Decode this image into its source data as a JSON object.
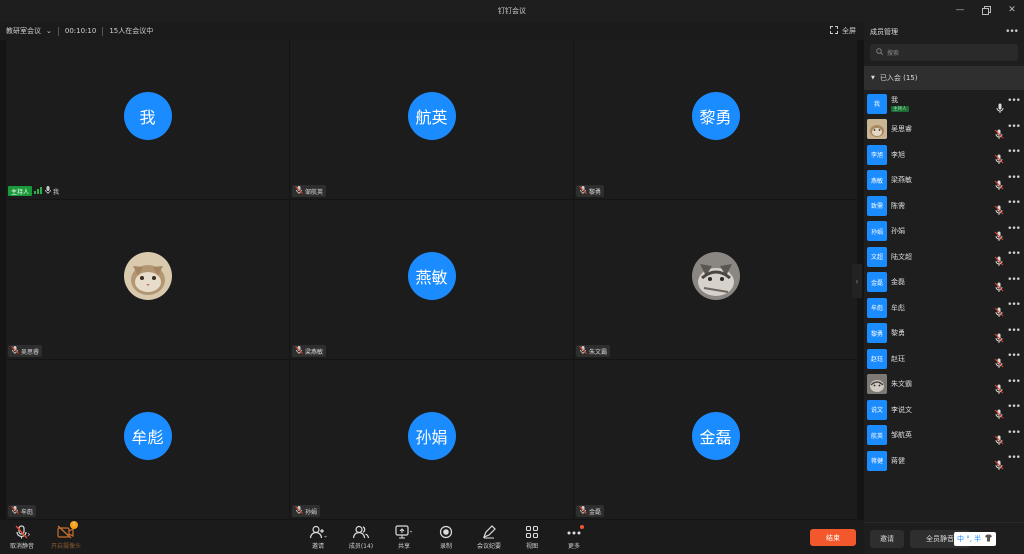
{
  "window": {
    "title": "钉钉会议"
  },
  "infobar": {
    "meeting_name": "教研室会议",
    "elapsed": "00:10:10",
    "attendance": "15人在会议中",
    "fullscreen_label": "全屏"
  },
  "tiles": [
    {
      "avatar_text": "我",
      "name": "我",
      "host_label": "主持人"
    },
    {
      "avatar_text": "航英",
      "name": "邹航英"
    },
    {
      "avatar_text": "黎勇",
      "name": "黎勇"
    },
    {
      "avatar_text": "",
      "name": "吴思睿"
    },
    {
      "avatar_text": "燕敏",
      "name": "梁燕敏"
    },
    {
      "avatar_text": "",
      "name": "朱文霸"
    },
    {
      "avatar_text": "牟彪",
      "name": "牟彪"
    },
    {
      "avatar_text": "孙娟",
      "name": "孙娟"
    },
    {
      "avatar_text": "金磊",
      "name": "金磊"
    }
  ],
  "toolbar": {
    "mute": "取消静音",
    "camera": "开启摄像头",
    "invite": "邀请",
    "members": "成员(14)",
    "share": "共享",
    "record": "录制",
    "minutes": "会议纪要",
    "view": "视图",
    "more": "更多",
    "end": "结束",
    "camera_badge": "!"
  },
  "panel": {
    "title": "成员管理",
    "search_placeholder": "搜索",
    "group_label": "已入会 (15)",
    "invite_button": "邀请",
    "mute_all_button": "全员静音",
    "ime_text": "中 °, 半"
  },
  "members": [
    {
      "avatar": "我",
      "name": "我",
      "tag": "主持人"
    },
    {
      "avatar": "",
      "name": "吴思睿"
    },
    {
      "avatar": "李旭",
      "name": "李旭"
    },
    {
      "avatar": "燕敏",
      "name": "梁燕敏"
    },
    {
      "avatar": "致需",
      "name": "陈需"
    },
    {
      "avatar": "孙娟",
      "name": "孙娟"
    },
    {
      "avatar": "文超",
      "name": "陆文超"
    },
    {
      "avatar": "金磊",
      "name": "金磊"
    },
    {
      "avatar": "牟彪",
      "name": "牟彪"
    },
    {
      "avatar": "黎勇",
      "name": "黎勇"
    },
    {
      "avatar": "赵珏",
      "name": "赵珏"
    },
    {
      "avatar": "",
      "name": "朱文霸"
    },
    {
      "avatar": "说文",
      "name": "李说文"
    },
    {
      "avatar": "航英",
      "name": "邹航英"
    },
    {
      "avatar": "蒋健",
      "name": "蒋健"
    }
  ],
  "colors": {
    "accent": "#1a8cff",
    "end": "#f2582b",
    "host": "#1b9a3b",
    "muted": "#e0452c"
  }
}
